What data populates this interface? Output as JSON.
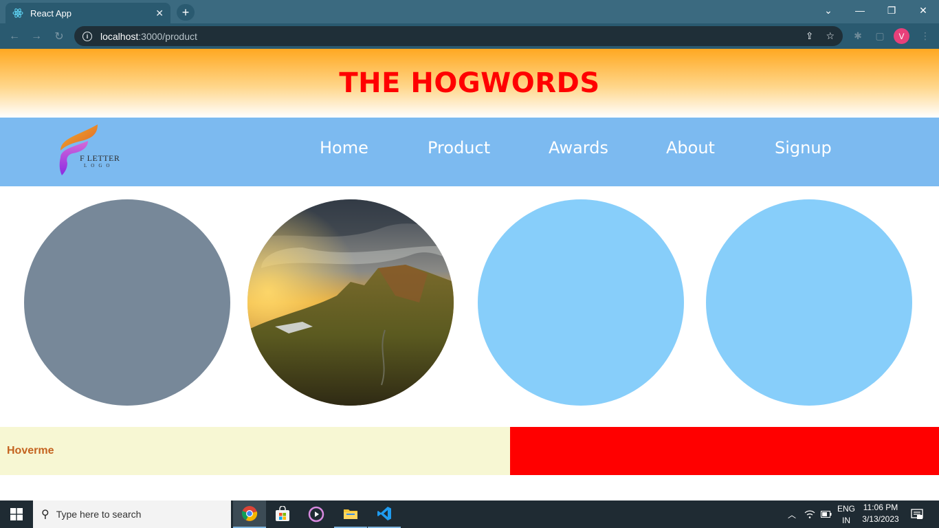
{
  "browser": {
    "tab_title": "React App",
    "tab_close": "✕",
    "new_tab": "+",
    "url_host": "localhost",
    "url_path": ":3000/product",
    "profile_initial": "V",
    "window_controls": {
      "minimize": "—",
      "restore": "❐",
      "close": "✕",
      "tab_search": "⌄"
    }
  },
  "header": {
    "title": "THE HOGWORDS"
  },
  "navbar": {
    "logo_text": "F LETTER",
    "logo_sub": "LOGO",
    "links": [
      "Home",
      "Product",
      "Awards",
      "About",
      "Signup"
    ]
  },
  "circles": [
    {
      "fill": "#778899"
    },
    {
      "fill": "image",
      "description": "mountain-landscape"
    },
    {
      "fill": "#87cefa"
    },
    {
      "fill": "#87cefa"
    }
  ],
  "hover": {
    "label": "Hoverme",
    "left_color": "#f7f7d3",
    "right_color": "#ff0000"
  },
  "taskbar": {
    "search_placeholder": "Type here to search",
    "lang_line1": "ENG",
    "lang_line2": "IN",
    "time": "11:06 PM",
    "date": "3/13/2023"
  },
  "colors": {
    "title_red": "#ff0000",
    "navbar_blue": "#7cbaf0",
    "header_orange": "#ffa821"
  }
}
